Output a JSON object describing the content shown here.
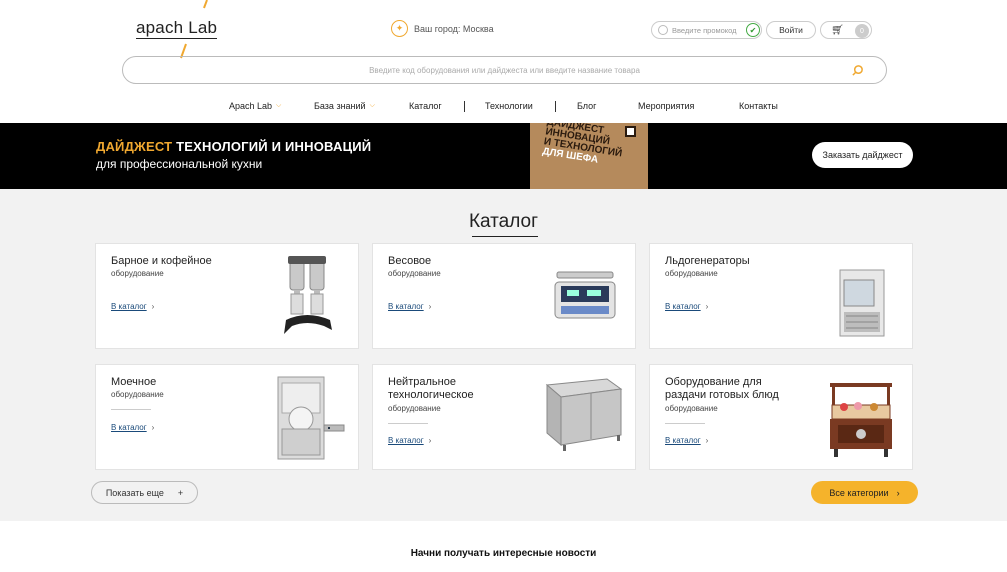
{
  "header": {
    "logo": "apach Lab",
    "city_label": "Ваш город: Москва",
    "promo_placeholder": "Введите промокод",
    "login_label": "Войти",
    "cart_count": "0"
  },
  "search": {
    "placeholder": "Введите код оборудования или дайджеста или введите название товара"
  },
  "nav": {
    "items": [
      {
        "label": "Apach Lab"
      },
      {
        "label": "База знаний"
      },
      {
        "label": "Каталог"
      },
      {
        "label": "Технологии"
      },
      {
        "label": "Блог"
      },
      {
        "label": "Мероприятия"
      },
      {
        "label": "Контакты"
      }
    ]
  },
  "banner": {
    "title_accent": "ДАЙДЖЕСТ",
    "title_rest": " ТЕХНОЛОГИЙ И ИННОВАЦИЙ",
    "subtitle": "для профессиональной кухни",
    "book_line1": "ДАЙДЖЕСТ",
    "book_line2": "ИННОВАЦИЙ",
    "book_line3": "И ТЕХНОЛОГИЙ",
    "book_line4": "ДЛЯ ШЕФА",
    "order_label": "Заказать дайджест"
  },
  "catalog": {
    "title": "Каталог",
    "cards": [
      {
        "title": "Барное и кофейное",
        "sub": "оборудование",
        "link": "В каталог",
        "icon": "blender-icon"
      },
      {
        "title": "Весовое",
        "sub": "оборудование",
        "link": "В каталог",
        "icon": "scale-icon"
      },
      {
        "title": "Льдогенераторы",
        "sub": "оборудование",
        "link": "В каталог",
        "icon": "ice-maker-icon"
      },
      {
        "title": "Моечное",
        "sub": "оборудование",
        "link": "В каталог",
        "icon": "dishwasher-icon"
      },
      {
        "title": "Нейтральное технологическое",
        "sub": "оборудование",
        "link": "В каталог",
        "icon": "table-icon"
      },
      {
        "title": "Оборудование для раздачи готовых блюд",
        "sub": "оборудование",
        "link": "В каталог",
        "icon": "buffet-icon"
      }
    ],
    "more_label": "Показать еще",
    "more_icon": "+",
    "all_label": "Все категории"
  },
  "newsletter": {
    "title": "Начни получать интересные новости"
  },
  "colors": {
    "accent": "#f5b32b",
    "banner_bg": "#000000",
    "catalog_bg": "#f2f2f2"
  }
}
